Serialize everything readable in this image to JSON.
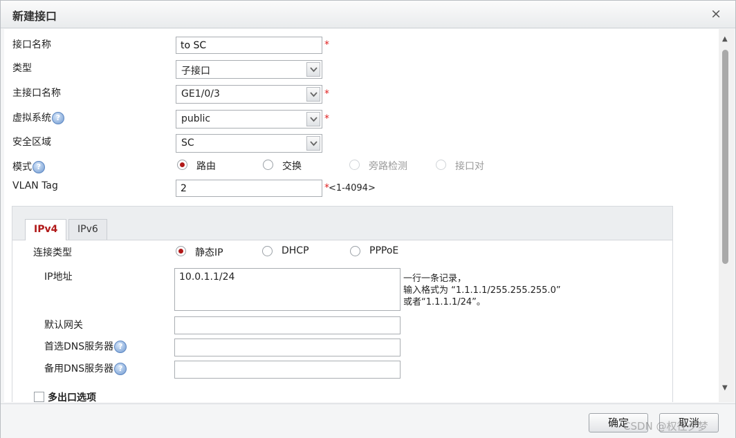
{
  "dialog": {
    "title": "新建接口",
    "close": "×"
  },
  "form": {
    "name_label": "接口名称",
    "name_value": "to SC",
    "type_label": "类型",
    "type_value": "子接口",
    "parent_label": "主接口名称",
    "parent_value": "GE1/0/3",
    "vsys_label": "虚拟系统",
    "vsys_value": "public",
    "zone_label": "安全区域",
    "zone_value": "SC",
    "mode_label": "模式",
    "mode_options": [
      "路由",
      "交换",
      "旁路检测",
      "接口对"
    ],
    "vlan_label": "VLAN Tag",
    "vlan_value": "2",
    "vlan_range": "<1-4094>",
    "required": "*",
    "help": "?"
  },
  "tabs": [
    "IPv4",
    "IPv6"
  ],
  "ipv4": {
    "conn_label": "连接类型",
    "conn_options": [
      "静态IP",
      "DHCP",
      "PPPoE"
    ],
    "ip_label": "IP地址",
    "ip_value": "10.0.1.1/24",
    "hint_1": "一行一条记录，",
    "hint_2": "输入格式为 “1.1.1.1/255.255.255.0”",
    "hint_3": "或者“1.1.1.1/24”。",
    "gw_label": "默认网关",
    "dns1_label": "首选DNS服务器",
    "dns2_label": "备用DNS服务器",
    "multi_label": "多出口选项"
  },
  "footer": {
    "ok": "确定",
    "cancel": "取消"
  },
  "watermark": "CSDN @权往夕梦"
}
